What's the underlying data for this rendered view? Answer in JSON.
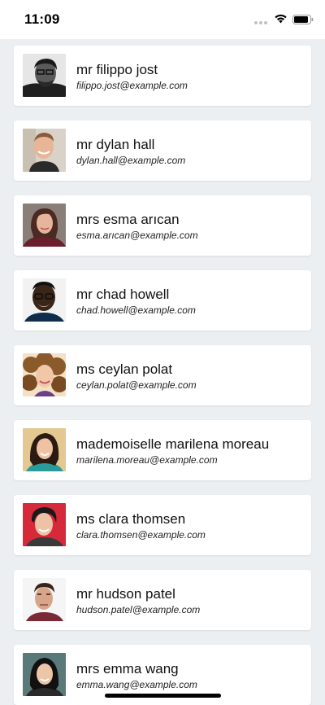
{
  "status_bar": {
    "time": "11:09",
    "icons": [
      "signal-dots-icon",
      "wifi-icon",
      "battery-icon"
    ]
  },
  "contacts": [
    {
      "name": "mr filippo jost",
      "email": "filippo.jost@example.com",
      "avatar": "portrait-man-glasses-bw"
    },
    {
      "name": "mr dylan hall",
      "email": "dylan.hall@example.com",
      "avatar": "portrait-man-smiling"
    },
    {
      "name": "mrs esma arıcan",
      "email": "esma.arıcan@example.com",
      "avatar": "portrait-woman-dark-hair"
    },
    {
      "name": "mr chad howell",
      "email": "chad.howell@example.com",
      "avatar": "portrait-man-glasses"
    },
    {
      "name": "ms ceylan polat",
      "email": "ceylan.polat@example.com",
      "avatar": "portrait-woman-curly-hair"
    },
    {
      "name": "mademoiselle marilena moreau",
      "email": "marilena.moreau@example.com",
      "avatar": "portrait-woman-brown-hair"
    },
    {
      "name": "ms clara thomsen",
      "email": "clara.thomsen@example.com",
      "avatar": "portrait-woman-red-background"
    },
    {
      "name": "mr hudson patel",
      "email": "hudson.patel@example.com",
      "avatar": "portrait-man-dark-hair"
    },
    {
      "name": "mrs emma wang",
      "email": "emma.wang@example.com",
      "avatar": "portrait-woman-outdoor"
    }
  ],
  "colors": {
    "background": "#eceff1",
    "card": "#ffffff",
    "text": "#111111"
  }
}
